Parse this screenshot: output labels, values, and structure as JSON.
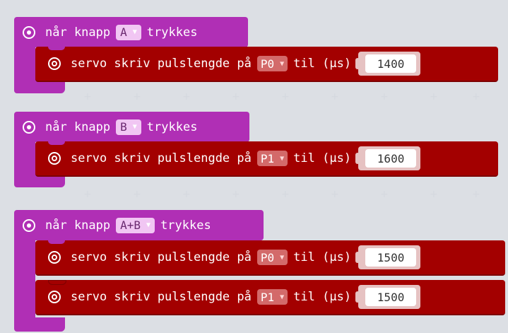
{
  "colors": {
    "event": "#b02fb5",
    "servo": "#a30000",
    "workspace": "#eceef1"
  },
  "icons": {
    "event": "radio-button-icon",
    "servo": "target-icon"
  },
  "events": [
    {
      "when": "når knapp",
      "button": "A",
      "pressed": "trykkes",
      "statements": [
        {
          "text": "servo skriv pulslengde på",
          "pin": "P0",
          "until": "til (µs)",
          "value": "1400"
        }
      ]
    },
    {
      "when": "når knapp",
      "button": "B",
      "pressed": "trykkes",
      "statements": [
        {
          "text": "servo skriv pulslengde på",
          "pin": "P1",
          "until": "til (µs)",
          "value": "1600"
        }
      ]
    },
    {
      "when": "når knapp",
      "button": "A+B",
      "pressed": "trykkes",
      "statements": [
        {
          "text": "servo skriv pulslengde på",
          "pin": "P0",
          "until": "til (µs)",
          "value": "1500"
        },
        {
          "text": "servo skriv pulslengde på",
          "pin": "P1",
          "until": "til (µs)",
          "value": "1500"
        }
      ]
    }
  ]
}
